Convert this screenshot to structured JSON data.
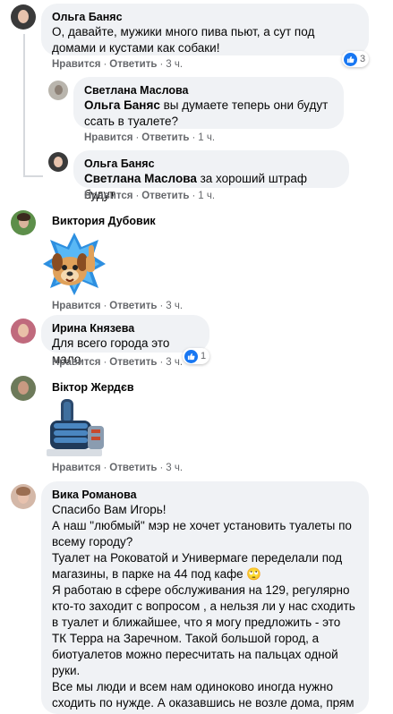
{
  "actions": {
    "like": "Нравится",
    "reply": "Ответить"
  },
  "comments": [
    {
      "author": "Ольга Баняс",
      "text": "О, давайте, мужики много пива пьют, а сут под домами и кустами как собаки!",
      "time": "3 ч.",
      "reactions": "3"
    },
    {
      "author": "Светлана Маслова",
      "mention": "Ольга Баняс",
      "text": " вы думаете теперь они будут ссать в туалете?",
      "time": "1 ч."
    },
    {
      "author": "Ольга Баняс",
      "mention": "Светлана Маслова",
      "text": " за хороший штраф будут",
      "time": "1 ч."
    },
    {
      "author": "Виктория Дубовик",
      "sticker": "dog-thumbs-up-sticker",
      "time": "3 ч."
    },
    {
      "author": "Ирина Князева",
      "text": "Для всего города это мало",
      "time": "3 ч.",
      "reactions": "1"
    },
    {
      "author": "Віктор Жердєв",
      "sticker": "robot-thumbs-up-sticker",
      "time": "3 ч."
    },
    {
      "author": "Вика Романова",
      "lines": [
        "Спасибо Вам Игорь!",
        "А наш \"любмый\" мэр не хочет установить туалеты по всему городу?",
        "Туалет на Роковатой и Универмаге переделали под магазины, в парке на 44 под кафе 🙄",
        "Я работаю в сфере обслуживания на 129, регулярно кто-то заходит с вопросом , а нельзя ли у нас сходить в туалет и ближайшее, что я могу предложить - это ТК Терра на Заречном. Такой большой город, а биотуалетов можно пересчитать на пальцах одной руки.",
        "Все мы люди и всем нам одиноково иногда нужно сходить по нужде. А оказавшись не возле дома, прям"
      ]
    }
  ],
  "colors": {
    "bubble": "#f0f2f5",
    "meta": "#65676b",
    "like": "#1877f2"
  }
}
